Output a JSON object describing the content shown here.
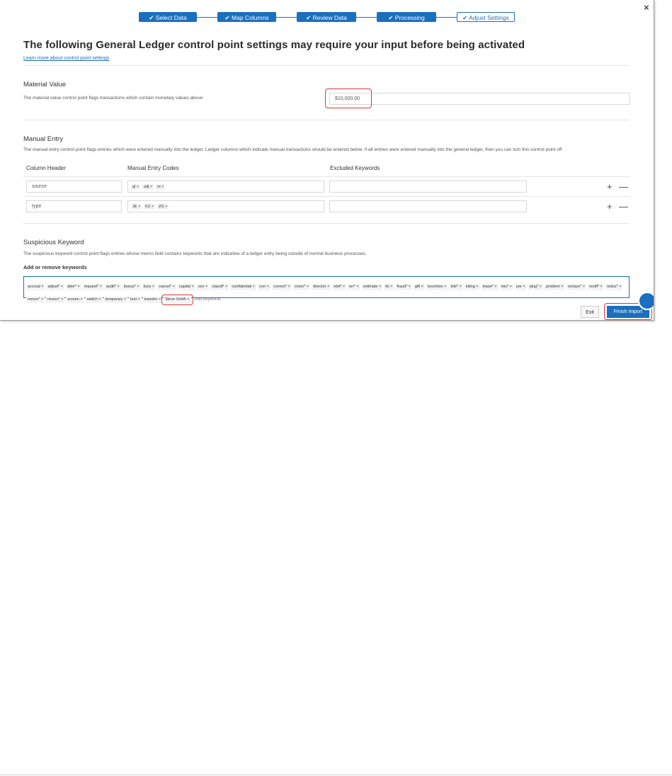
{
  "stepper": {
    "steps": [
      {
        "label": "Select Data",
        "state": "done"
      },
      {
        "label": "Map Columns",
        "state": "done"
      },
      {
        "label": "Review Data",
        "state": "done"
      },
      {
        "label": "Processing",
        "state": "done"
      },
      {
        "label": "Adjust Settings",
        "state": "current"
      }
    ],
    "check": "✔"
  },
  "close_glyph": "×",
  "page": {
    "title": "The following General Ledger control point settings may require your input before being activated",
    "learn_more": "Learn more about control point settings"
  },
  "material_value": {
    "title": "Material Value",
    "description": "The material value control point flags transactions which contain monetary values above:",
    "value": "$10,000.00"
  },
  "manual_entry": {
    "title": "Manual Entry",
    "description": "The manual entry control point flags entries which were entered manually into the ledger. Ledger columns which indicate manual transactions should be entered below. If all entries were entered manually into the general ledger, then you can turn this control point off",
    "headers": {
      "column_header": "Column Header",
      "codes": "Manual Entry Codes",
      "excluded": "Excluded Keywords"
    },
    "rows": [
      {
        "column": "source",
        "codes": [
          "gl",
          "adj",
          "m"
        ],
        "excluded": ""
      },
      {
        "column": "type",
        "codes": [
          "JE",
          "KZ",
          "ZG"
        ],
        "excluded": ""
      }
    ],
    "plus": "+",
    "minus": "—",
    "chip_x": "×"
  },
  "suspicious_keyword": {
    "title": "Suspicious Keyword",
    "description": "The suspicious keyword control point flags entries whose memo field contains keywords that are indicative of a ledger entry being outside of normal business processes.",
    "add_label": "Add or remove keywords",
    "keywords": [
      "accrual",
      "adjust*",
      "alter*",
      "request*",
      "audit*",
      "bonus*",
      "bury",
      "cancel*",
      "capital",
      "ceo",
      "classif*",
      "confidential",
      "corr",
      "correct*",
      "cover*",
      "director",
      "ebit*",
      "err*",
      "estimate",
      "fix",
      "fraud*",
      "gift",
      "incentive",
      "kite*",
      "kiting",
      "lease*",
      "mis*",
      "per",
      "plug*",
      "problem",
      "reclass*",
      "rectif*",
      "reduc*",
      "remov*",
      "revers*",
      "screen",
      "switch",
      "temporary",
      "test",
      "transfer",
      "Steve Smith"
    ],
    "placeholder": "Add keywords"
  },
  "buttons": {
    "exit": "Exit",
    "finish": "Finish Import"
  },
  "colors": {
    "accent": "#1a6fbf",
    "highlight": "#d9383a"
  }
}
